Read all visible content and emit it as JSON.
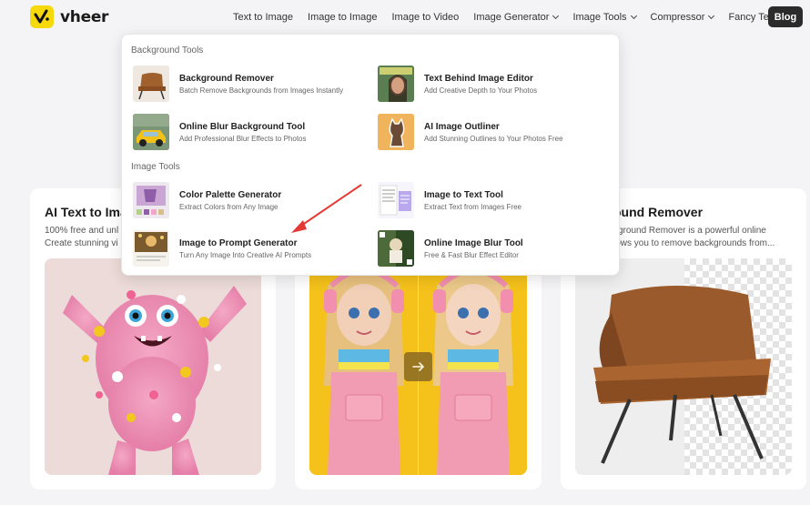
{
  "brand": {
    "name": "vheer",
    "color": "#f5d90a"
  },
  "nav": {
    "items": [
      {
        "label": "Text to Image",
        "dropdown": false
      },
      {
        "label": "Image to Image",
        "dropdown": false
      },
      {
        "label": "Image to Video",
        "dropdown": false
      },
      {
        "label": "Image Generator",
        "dropdown": true
      },
      {
        "label": "Image Tools",
        "dropdown": true
      },
      {
        "label": "Compressor",
        "dropdown": true
      },
      {
        "label": "Fancy Text",
        "dropdown": true
      }
    ],
    "blog_label": "Blog"
  },
  "dropdown": {
    "background_section": "Background Tools",
    "image_section": "Image Tools",
    "tools": [
      {
        "name": "Background Remover",
        "desc": "Batch Remove Backgrounds from Images Instantly"
      },
      {
        "name": "Text Behind Image Editor",
        "desc": "Add Creative Depth to Your Photos"
      },
      {
        "name": "Online Blur Background Tool",
        "desc": "Add Professional Blur Effects to Photos"
      },
      {
        "name": "AI Image Outliner",
        "desc": "Add Stunning Outlines to Your Photos Free"
      },
      {
        "name": "Color Palette Generator",
        "desc": "Extract Colors from Any Image"
      },
      {
        "name": "Image to Text Tool",
        "desc": "Extract Text from Images Free"
      },
      {
        "name": "Image to Prompt Generator",
        "desc": "Turn Any Image Into Creative AI Prompts"
      },
      {
        "name": "Online Image Blur Tool",
        "desc": "Free & Fast Blur Effect Editor"
      }
    ]
  },
  "cards": [
    {
      "title": "AI Text to Ima",
      "desc_line1": "100% free and unl",
      "desc_line2": "Create stunning vi"
    },
    {
      "title": "",
      "desc_line1": "",
      "desc_line2": ""
    },
    {
      "title": "ound Remover",
      "desc_line1": "kground Remover is a powerful online",
      "desc_line2": "lows you to remove backgrounds from..."
    }
  ],
  "annotation_color": "#e53935"
}
